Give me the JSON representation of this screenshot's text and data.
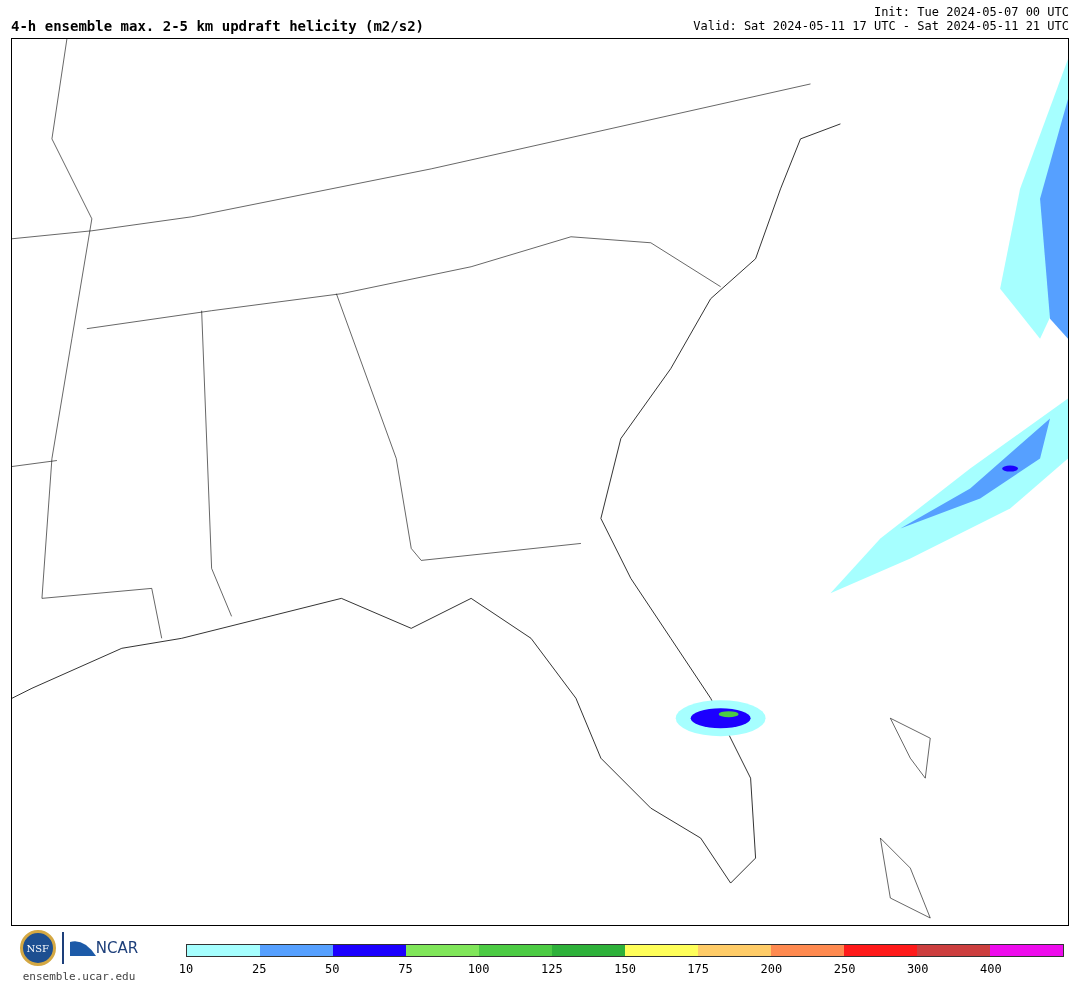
{
  "title": "4-h ensemble max. 2-5 km updraft helicity (m2/s2)",
  "init": "Init: Tue 2024-05-07 00 UTC",
  "valid": "Valid: Sat 2024-05-11 17 UTC - Sat 2024-05-11 21 UTC",
  "logos": {
    "nsf": "NSF",
    "ncar": "NCAR",
    "site": "ensemble.ucar.edu"
  },
  "legend": {
    "bins": [
      {
        "color": "#a6ffff",
        "tick": "10"
      },
      {
        "color": "#56a0ff",
        "tick": "25"
      },
      {
        "color": "#1c00ff",
        "tick": "50"
      },
      {
        "color": "#80e65a",
        "tick": "75"
      },
      {
        "color": "#4ccb44",
        "tick": "100"
      },
      {
        "color": "#2eb13a",
        "tick": "125"
      },
      {
        "color": "#ffff5a",
        "tick": "150"
      },
      {
        "color": "#ffcc68",
        "tick": "175"
      },
      {
        "color": "#ff8a50",
        "tick": "200"
      },
      {
        "color": "#ff1a1a",
        "tick": "250"
      },
      {
        "color": "#cc3e3e",
        "tick": "300"
      },
      {
        "color": "#ee0ced",
        "tick": "400"
      }
    ]
  }
}
